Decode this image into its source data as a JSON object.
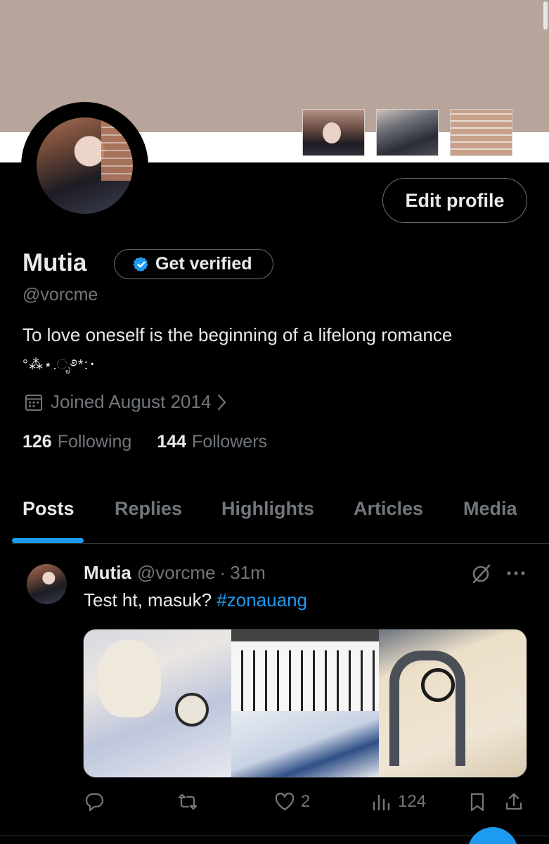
{
  "profile": {
    "name": "Mutia",
    "handle": "@vorcme",
    "verify_label": "Get verified",
    "edit_label": "Edit profile",
    "bio": "To love oneself is the beginning of a lifelong romance",
    "bio_deco": "°⁂⋆.ೃ࿔*:･",
    "joined": "Joined August 2014",
    "following_count": "126",
    "following_label": "Following",
    "followers_count": "144",
    "followers_label": "Followers"
  },
  "tabs": [
    {
      "label": "Posts",
      "active": true
    },
    {
      "label": "Replies"
    },
    {
      "label": "Highlights"
    },
    {
      "label": "Articles"
    },
    {
      "label": "Media"
    }
  ],
  "post": {
    "name": "Mutia",
    "handle": "@vorcme",
    "separator": "·",
    "time": "31m",
    "text": "Test ht, masuk? ",
    "hashtag": "#zonauang",
    "likes": "2",
    "views": "124"
  },
  "icons": {
    "verify": "verified-badge-icon",
    "calendar": "calendar-icon",
    "reply": "reply-icon",
    "repost": "repost-icon",
    "like": "heart-icon",
    "views": "views-icon",
    "bookmark": "bookmark-icon",
    "share": "share-icon",
    "grok": "grok-icon",
    "more": "more-icon"
  },
  "colors": {
    "accent": "#1d9bf0",
    "banner": "#b7a49b",
    "muted_text": "#71767b"
  }
}
